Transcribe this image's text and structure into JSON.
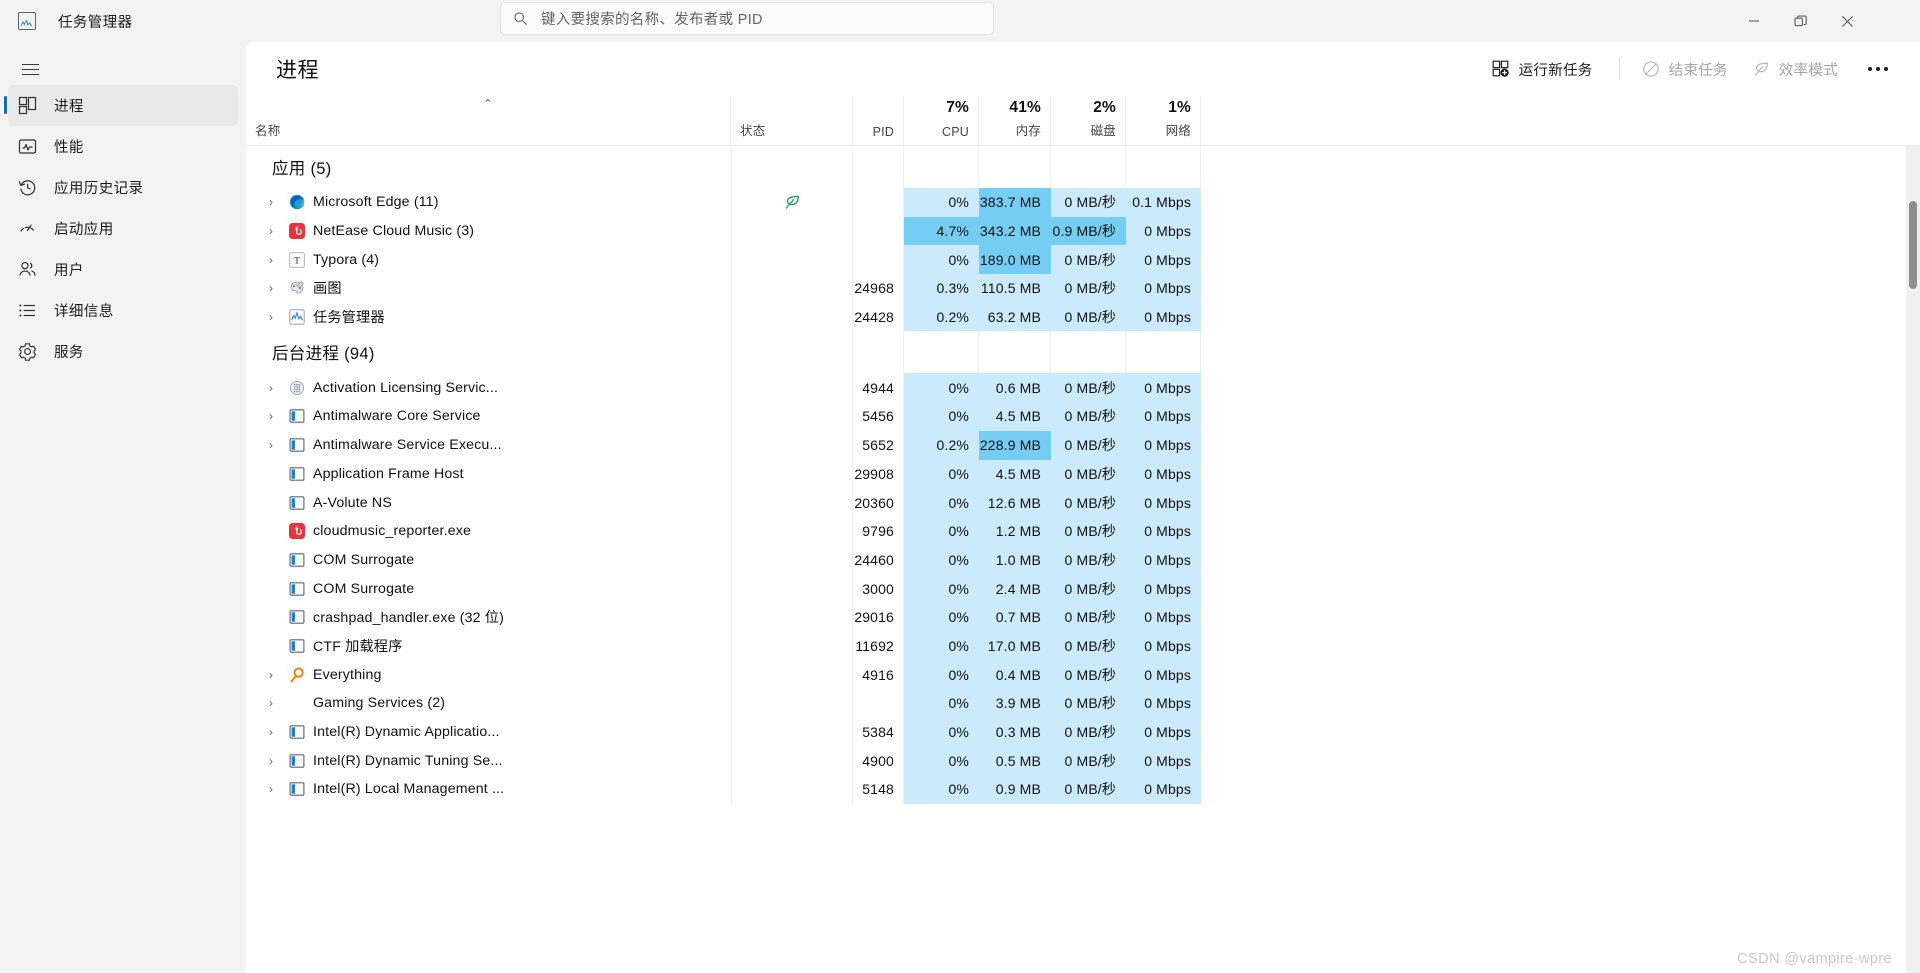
{
  "window": {
    "title": "任务管理器",
    "app_icon": "chart-icon",
    "controls": {
      "minimize": "minimize-icon",
      "maximize": "restore-icon",
      "close": "close-icon"
    }
  },
  "search": {
    "placeholder": "键入要搜索的名称、发布者或 PID",
    "value": "",
    "icon": "search-icon"
  },
  "sidebar": {
    "menu_icon": "hamburger-icon",
    "items": [
      {
        "label": "进程",
        "icon": "processes-icon",
        "active": true
      },
      {
        "label": "性能",
        "icon": "performance-icon",
        "active": false
      },
      {
        "label": "应用历史记录",
        "icon": "history-icon",
        "active": false
      },
      {
        "label": "启动应用",
        "icon": "startup-icon",
        "active": false
      },
      {
        "label": "用户",
        "icon": "users-icon",
        "active": false
      },
      {
        "label": "详细信息",
        "icon": "details-icon",
        "active": false
      },
      {
        "label": "服务",
        "icon": "services-icon",
        "active": false
      }
    ]
  },
  "page": {
    "title": "进程",
    "toolbar": {
      "run_new_task": {
        "label": "运行新任务",
        "icon": "new-task-icon",
        "enabled": true
      },
      "end_task": {
        "label": "结束任务",
        "icon": "end-task-icon",
        "enabled": false
      },
      "efficiency_mode": {
        "label": "效率模式",
        "icon": "leaf-icon",
        "enabled": false
      },
      "more": {
        "label": "···",
        "icon": "more-icon"
      }
    }
  },
  "table": {
    "sort_column": "名称",
    "sort_direction": "asc",
    "columns": [
      {
        "key": "name",
        "caption": "名称",
        "pct": ""
      },
      {
        "key": "status",
        "caption": "状态",
        "pct": ""
      },
      {
        "key": "pid",
        "caption": "PID",
        "pct": ""
      },
      {
        "key": "cpu",
        "caption": "CPU",
        "pct": "7%"
      },
      {
        "key": "mem",
        "caption": "内存",
        "pct": "41%"
      },
      {
        "key": "disk",
        "caption": "磁盘",
        "pct": "2%"
      },
      {
        "key": "net",
        "caption": "网络",
        "pct": "1%"
      }
    ],
    "sections": [
      {
        "title": "应用 (5)",
        "rows": [
          {
            "name": "Microsoft Edge (11)",
            "icon": "edge-icon",
            "expandable": true,
            "status": "leaf-icon",
            "pid": "",
            "cpu": "0%",
            "mem": "383.7 MB",
            "disk": "0 MB/秒",
            "net": "0.1 Mbps",
            "heat": {
              "cpu": 1,
              "mem": 2,
              "disk": 1,
              "net": 1
            }
          },
          {
            "name": "NetEase Cloud Music (3)",
            "icon": "netease-icon",
            "expandable": true,
            "status": "",
            "pid": "",
            "cpu": "4.7%",
            "mem": "343.2 MB",
            "disk": "0.9 MB/秒",
            "net": "0 Mbps",
            "heat": {
              "cpu": 2,
              "mem": 2,
              "disk": 2,
              "net": 1
            }
          },
          {
            "name": "Typora (4)",
            "icon": "typora-icon",
            "expandable": true,
            "status": "",
            "pid": "",
            "cpu": "0%",
            "mem": "189.0 MB",
            "disk": "0 MB/秒",
            "net": "0 Mbps",
            "heat": {
              "cpu": 1,
              "mem": 2,
              "disk": 1,
              "net": 1
            }
          },
          {
            "name": "画图",
            "icon": "paint-icon",
            "expandable": true,
            "status": "",
            "pid": "24968",
            "cpu": "0.3%",
            "mem": "110.5 MB",
            "disk": "0 MB/秒",
            "net": "0 Mbps",
            "heat": {
              "cpu": 1,
              "mem": 1,
              "disk": 1,
              "net": 1
            }
          },
          {
            "name": "任务管理器",
            "icon": "taskmgr-icon",
            "expandable": true,
            "status": "",
            "pid": "24428",
            "cpu": "0.2%",
            "mem": "63.2 MB",
            "disk": "0 MB/秒",
            "net": "0 Mbps",
            "heat": {
              "cpu": 1,
              "mem": 1,
              "disk": 1,
              "net": 1
            }
          }
        ]
      },
      {
        "title": "后台进程 (94)",
        "rows": [
          {
            "name": "Activation Licensing Servic...",
            "icon": "generic-dll-icon",
            "expandable": true,
            "status": "",
            "pid": "4944",
            "cpu": "0%",
            "mem": "0.6 MB",
            "disk": "0 MB/秒",
            "net": "0 Mbps",
            "heat": {
              "cpu": 1,
              "mem": 1,
              "disk": 1,
              "net": 1
            }
          },
          {
            "name": "Antimalware Core Service",
            "icon": "window-icon",
            "expandable": true,
            "status": "",
            "pid": "5456",
            "cpu": "0%",
            "mem": "4.5 MB",
            "disk": "0 MB/秒",
            "net": "0 Mbps",
            "heat": {
              "cpu": 1,
              "mem": 1,
              "disk": 1,
              "net": 1
            }
          },
          {
            "name": "Antimalware Service Execu...",
            "icon": "window-icon",
            "expandable": true,
            "status": "",
            "pid": "5652",
            "cpu": "0.2%",
            "mem": "228.9 MB",
            "disk": "0 MB/秒",
            "net": "0 Mbps",
            "heat": {
              "cpu": 1,
              "mem": 2,
              "disk": 1,
              "net": 1
            }
          },
          {
            "name": "Application Frame Host",
            "icon": "window-icon",
            "expandable": false,
            "status": "",
            "pid": "29908",
            "cpu": "0%",
            "mem": "4.5 MB",
            "disk": "0 MB/秒",
            "net": "0 Mbps",
            "heat": {
              "cpu": 1,
              "mem": 1,
              "disk": 1,
              "net": 1
            }
          },
          {
            "name": "A-Volute NS",
            "icon": "window-icon",
            "expandable": false,
            "status": "",
            "pid": "20360",
            "cpu": "0%",
            "mem": "12.6 MB",
            "disk": "0 MB/秒",
            "net": "0 Mbps",
            "heat": {
              "cpu": 1,
              "mem": 1,
              "disk": 1,
              "net": 1
            }
          },
          {
            "name": "cloudmusic_reporter.exe",
            "icon": "netease-icon",
            "expandable": false,
            "status": "",
            "pid": "9796",
            "cpu": "0%",
            "mem": "1.2 MB",
            "disk": "0 MB/秒",
            "net": "0 Mbps",
            "heat": {
              "cpu": 1,
              "mem": 1,
              "disk": 1,
              "net": 1
            }
          },
          {
            "name": "COM Surrogate",
            "icon": "window-icon",
            "expandable": false,
            "status": "",
            "pid": "24460",
            "cpu": "0%",
            "mem": "1.0 MB",
            "disk": "0 MB/秒",
            "net": "0 Mbps",
            "heat": {
              "cpu": 1,
              "mem": 1,
              "disk": 1,
              "net": 1
            }
          },
          {
            "name": "COM Surrogate",
            "icon": "window-icon",
            "expandable": false,
            "status": "",
            "pid": "3000",
            "cpu": "0%",
            "mem": "2.4 MB",
            "disk": "0 MB/秒",
            "net": "0 Mbps",
            "heat": {
              "cpu": 1,
              "mem": 1,
              "disk": 1,
              "net": 1
            }
          },
          {
            "name": "crashpad_handler.exe (32 位)",
            "icon": "window-icon",
            "expandable": false,
            "status": "",
            "pid": "29016",
            "cpu": "0%",
            "mem": "0.7 MB",
            "disk": "0 MB/秒",
            "net": "0 Mbps",
            "heat": {
              "cpu": 1,
              "mem": 1,
              "disk": 1,
              "net": 1
            }
          },
          {
            "name": "CTF 加载程序",
            "icon": "window-icon",
            "expandable": false,
            "status": "",
            "pid": "11692",
            "cpu": "0%",
            "mem": "17.0 MB",
            "disk": "0 MB/秒",
            "net": "0 Mbps",
            "heat": {
              "cpu": 1,
              "mem": 1,
              "disk": 1,
              "net": 1
            }
          },
          {
            "name": "Everything",
            "icon": "everything-icon",
            "expandable": true,
            "status": "",
            "pid": "4916",
            "cpu": "0%",
            "mem": "0.4 MB",
            "disk": "0 MB/秒",
            "net": "0 Mbps",
            "heat": {
              "cpu": 1,
              "mem": 1,
              "disk": 1,
              "net": 1
            }
          },
          {
            "name": "Gaming Services (2)",
            "icon": "",
            "expandable": true,
            "status": "",
            "pid": "",
            "cpu": "0%",
            "mem": "3.9 MB",
            "disk": "0 MB/秒",
            "net": "0 Mbps",
            "heat": {
              "cpu": 1,
              "mem": 1,
              "disk": 1,
              "net": 1
            }
          },
          {
            "name": "Intel(R) Dynamic Applicatio...",
            "icon": "window-icon",
            "expandable": true,
            "status": "",
            "pid": "5384",
            "cpu": "0%",
            "mem": "0.3 MB",
            "disk": "0 MB/秒",
            "net": "0 Mbps",
            "heat": {
              "cpu": 1,
              "mem": 1,
              "disk": 1,
              "net": 1
            }
          },
          {
            "name": "Intel(R) Dynamic Tuning Se...",
            "icon": "window-icon",
            "expandable": true,
            "status": "",
            "pid": "4900",
            "cpu": "0%",
            "mem": "0.5 MB",
            "disk": "0 MB/秒",
            "net": "0 Mbps",
            "heat": {
              "cpu": 1,
              "mem": 1,
              "disk": 1,
              "net": 1
            }
          },
          {
            "name": "Intel(R) Local Management ...",
            "icon": "window-icon",
            "expandable": true,
            "status": "",
            "pid": "5148",
            "cpu": "0%",
            "mem": "0.9 MB",
            "disk": "0 MB/秒",
            "net": "0 Mbps",
            "heat": {
              "cpu": 1,
              "mem": 1,
              "disk": 1,
              "net": 1
            }
          }
        ]
      }
    ]
  },
  "watermark": "CSDN @vampire-wpre",
  "colors": {
    "accent": "#0f6cbd",
    "heat_light": "#cbeafb",
    "heat_strong": "#76cdf3",
    "sidebar_bg": "#f3f3f3",
    "content_bg": "#ffffff"
  }
}
